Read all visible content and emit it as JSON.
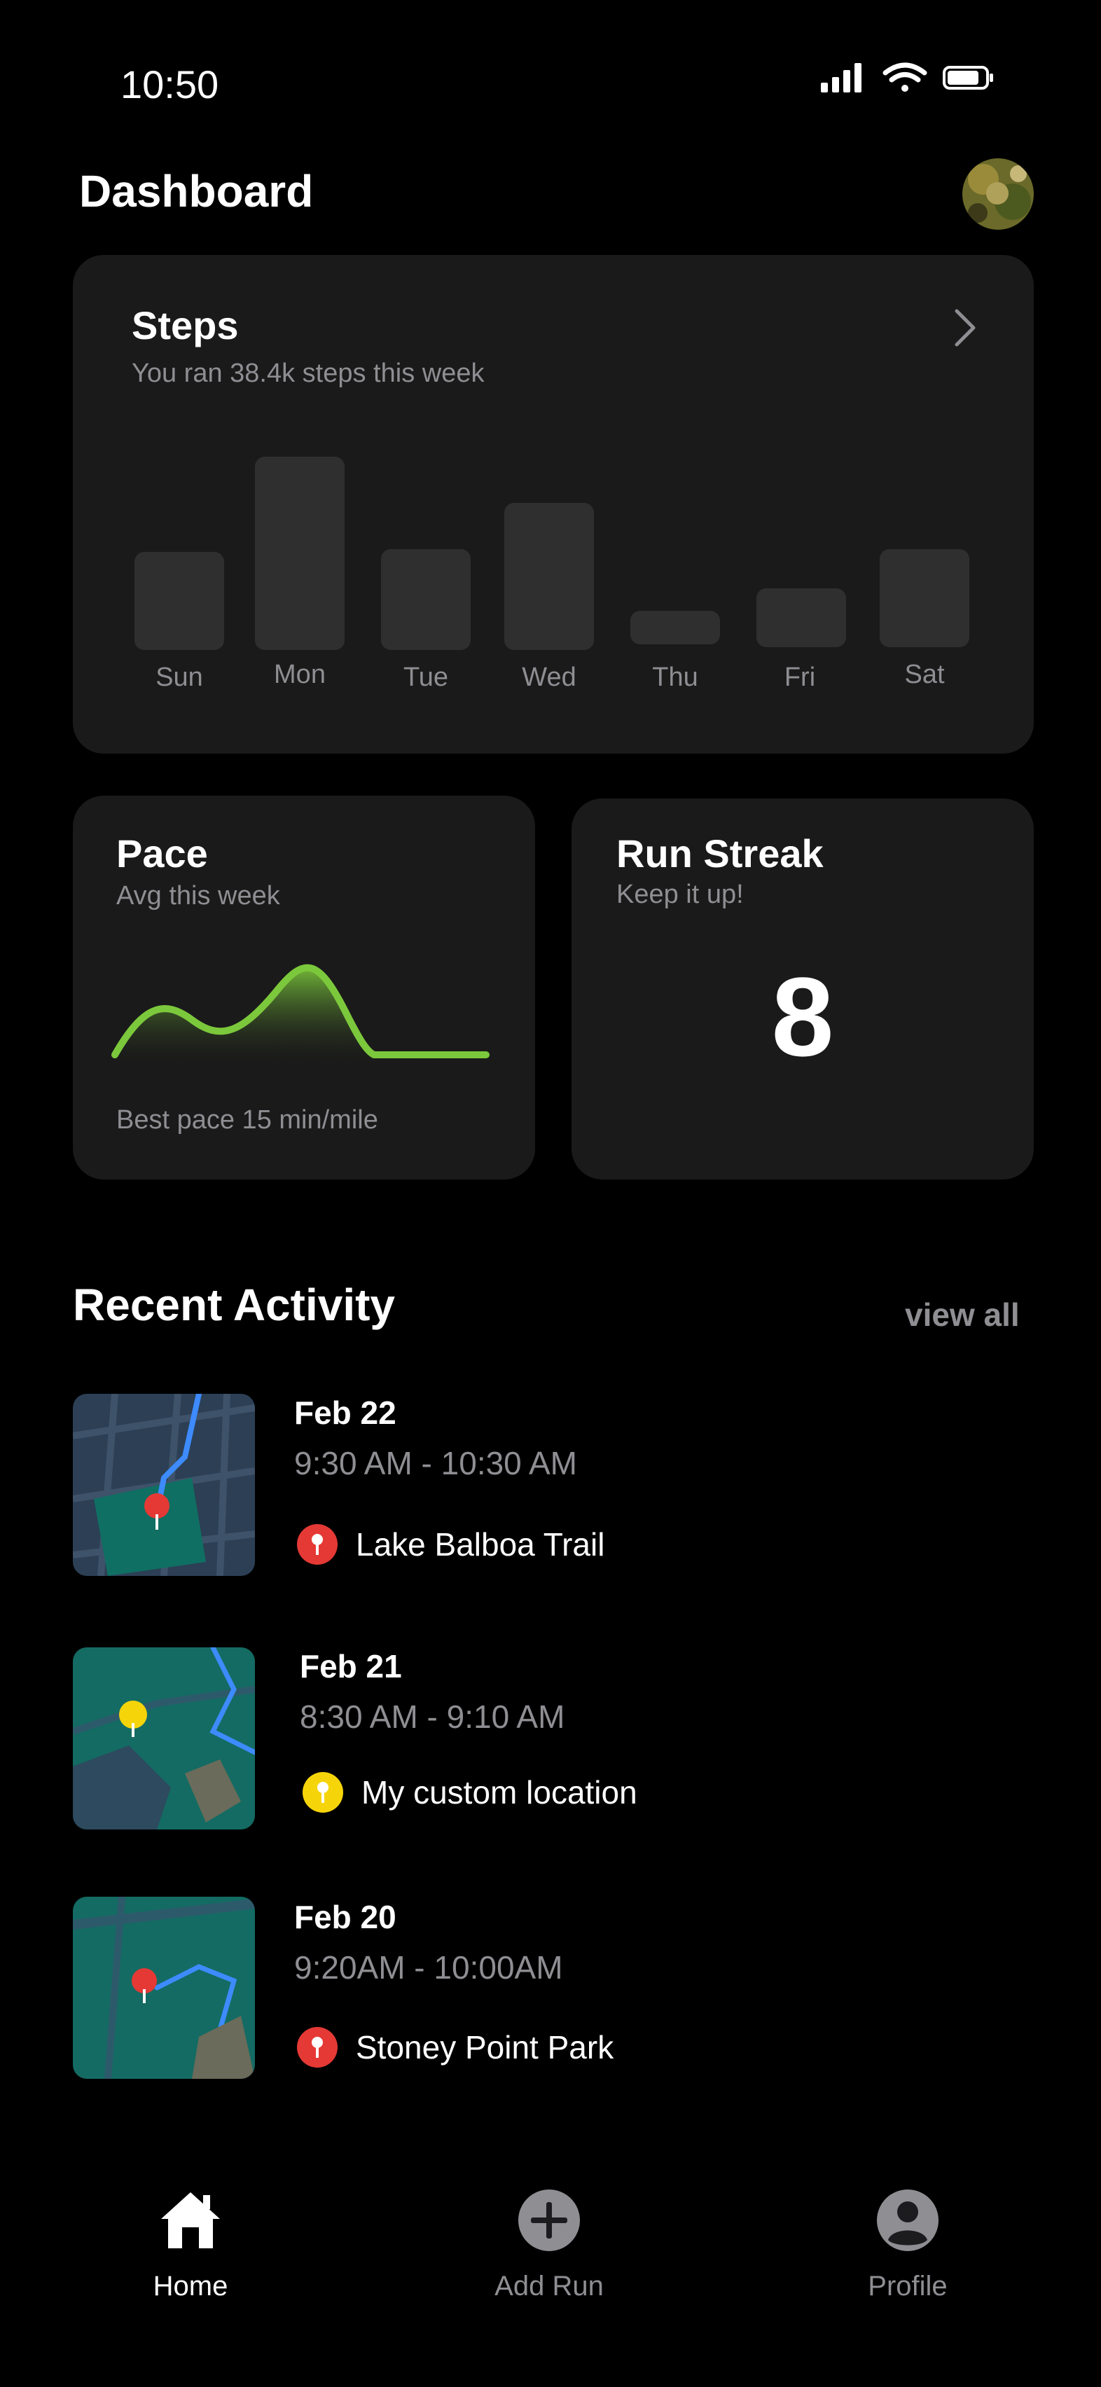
{
  "status_bar": {
    "time": "10:50"
  },
  "header": {
    "title": "Dashboard"
  },
  "steps": {
    "title": "Steps",
    "subtitle": "You ran 38.4k steps this week",
    "days": [
      "Sun",
      "Mon",
      "Tue",
      "Wed",
      "Thu",
      "Fri",
      "Sat"
    ]
  },
  "pace": {
    "title": "Pace",
    "subtitle": "Avg this week",
    "footer": "Best pace 15 min/mile"
  },
  "streak": {
    "title": "Run Streak",
    "subtitle": "Keep it up!",
    "value": "8"
  },
  "recent": {
    "title": "Recent Activity",
    "view_all": "view all",
    "items": [
      {
        "date": "Feb 22",
        "time": "9:30 AM - 10:30 AM",
        "location": "Lake Balboa Trail",
        "pin_color": "#e53935"
      },
      {
        "date": "Feb 21",
        "time": "8:30 AM - 9:10 AM",
        "location": "My custom location",
        "pin_color": "#f5d50a"
      },
      {
        "date": "Feb 20",
        "time": "9:20AM - 10:00AM",
        "location": "Stoney Point Park",
        "pin_color": "#e53935"
      }
    ]
  },
  "tabbar": {
    "home": "Home",
    "add_run": "Add Run",
    "profile": "Profile"
  },
  "colors": {
    "background": "#000000",
    "card": "#1a1a1a",
    "bar": "#2f2f2f",
    "accent_green": "#7cc83c",
    "muted": "#8e8e93"
  }
}
